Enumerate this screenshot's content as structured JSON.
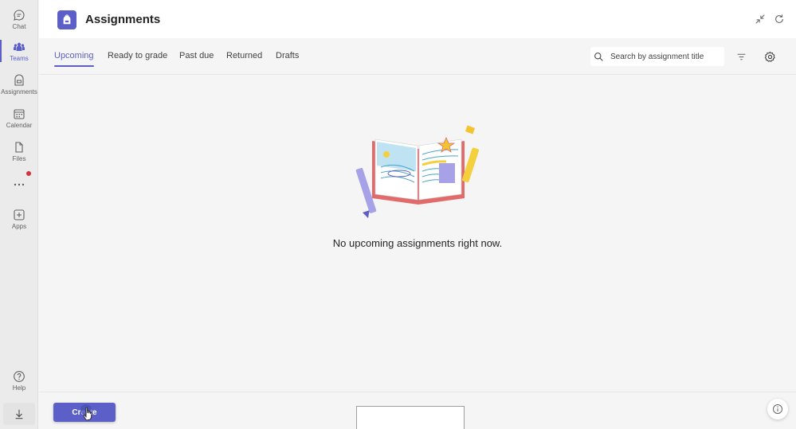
{
  "rail": {
    "items": [
      {
        "label": "Chat",
        "icon": "chat-icon"
      },
      {
        "label": "Teams",
        "icon": "teams-icon"
      },
      {
        "label": "Assignments",
        "icon": "assignments-icon"
      },
      {
        "label": "Calendar",
        "icon": "calendar-icon"
      },
      {
        "label": "Files",
        "icon": "files-icon"
      },
      {
        "label": "",
        "icon": "more-icon"
      },
      {
        "label": "Apps",
        "icon": "apps-icon"
      },
      {
        "label": "Help",
        "icon": "help-icon"
      }
    ],
    "active": "Teams"
  },
  "header": {
    "title": "Assignments",
    "accent_color": "#5b5fc7"
  },
  "tabs": [
    {
      "label": "Upcoming",
      "active": true
    },
    {
      "label": "Ready to grade",
      "active": false
    },
    {
      "label": "Past due",
      "active": false
    },
    {
      "label": "Returned",
      "active": false
    },
    {
      "label": "Drafts",
      "active": false
    }
  ],
  "search": {
    "placeholder": "Search by assignment title",
    "value": ""
  },
  "empty_state": {
    "message": "No upcoming assignments right now."
  },
  "footer": {
    "create_label": "Create"
  }
}
